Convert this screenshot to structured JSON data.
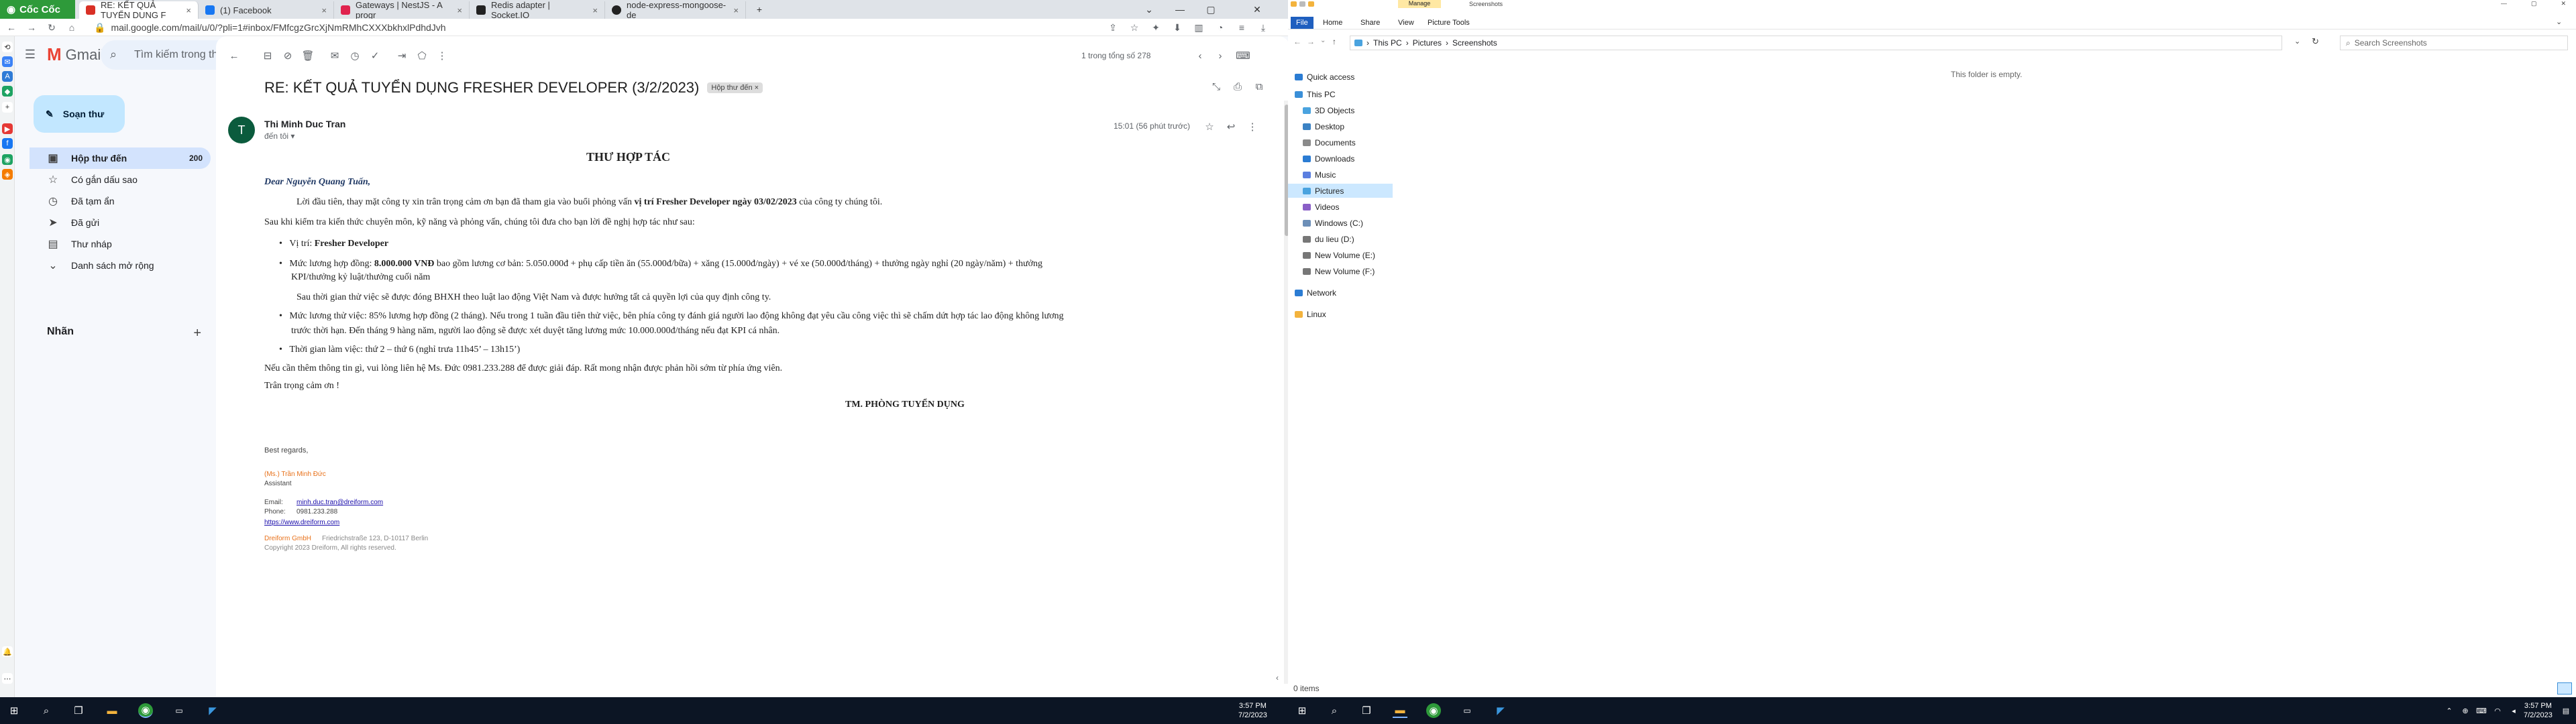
{
  "browser": {
    "brand": "Cốc Cốc",
    "tabs": [
      {
        "label": "RE: KẾT QUẢ TUYỂN DỤNG F",
        "color": "#d93025"
      },
      {
        "label": "(1) Facebook",
        "color": "#1877f2"
      },
      {
        "label": "Gateways | NestJS - A progr",
        "color": "#e0234e"
      },
      {
        "label": "Redis adapter | Socket.IO",
        "color": "#222222"
      },
      {
        "label": "node-express-mongoose-de",
        "color": "#222222"
      }
    ],
    "url": "mail.google.com/mail/u/0/?pli=1#inbox/FMfcgzGrcXjNmRMhCXXXbkhxlPdhdJvh"
  },
  "gmail": {
    "brand": "Gmail",
    "search_placeholder": "Tìm kiếm trong thư",
    "avatar_letter": "T",
    "compose_label": "Soạn thư",
    "nav": [
      {
        "label": "Hộp thư đến",
        "count": "200",
        "icon": "inbox-icon",
        "glyph": "▣"
      },
      {
        "label": "Có gắn dấu sao",
        "count": "",
        "icon": "star-icon",
        "glyph": "☆"
      },
      {
        "label": "Đã tạm ẩn",
        "count": "",
        "icon": "snooze-icon",
        "glyph": "◷"
      },
      {
        "label": "Đã gửi",
        "count": "",
        "icon": "send-icon",
        "glyph": "➤"
      },
      {
        "label": "Thư nháp",
        "count": "",
        "icon": "draft-icon",
        "glyph": "▤"
      },
      {
        "label": "Danh sách mở rộng",
        "count": "",
        "icon": "expand-icon",
        "glyph": "⌄"
      }
    ],
    "labels_title": "Nhãn",
    "labels_add": "+",
    "pager": "1 trong tổng số 278",
    "subject": "RE: KẾT QUẢ TUYỂN DỤNG FRESHER DEVELOPER (3/2/2023)",
    "subject_badge": "Hộp thư đến ×",
    "sender_name": "Thi Minh Duc Tran",
    "sender_to": "đến tôi ▾",
    "sender_avatar": "T",
    "time": "15:01 (56 phút trước)",
    "body": {
      "heading": "THƯ HỢP TÁC",
      "greeting": "Dear Nguyễn Quang Tuấn,",
      "p1_a": "Lời đầu tiên, thay mặt công ty xin trân trọng cảm ơn bạn đã tham gia vào buổi phỏng vấn ",
      "p1_b": "vị trí Fresher Developer ngày 03/02/2023",
      "p1_c": " của công ty chúng tôi.",
      "p2": "Sau khi kiểm tra kiến thức chuyên môn, kỹ năng và phỏng vấn, chúng tôi đưa cho bạn lời đề nghị hợp tác như sau:",
      "b1_a": "Vị trí: ",
      "b1_b": "Fresher Developer",
      "b2_a": "Mức lương hợp đồng: ",
      "b2_b": "8.000.000 VNĐ",
      "b2_c": " bao gồm lương cơ bản: 5.050.000đ + phụ cấp tiền ăn (55.000đ/bữa) + xăng (15.000đ/ngày) + vé xe (50.000đ/tháng) + thưởng ngày nghỉ (20 ngày/năm) + thưởng",
      "b2_d": "KPI/thưởng kỷ luật/thưởng cuối năm",
      "p3": "Sau thời gian thử việc sẽ được đóng BHXH theo luật lao động Việt Nam và được hưởng tất cả quyền lợi của quy định công ty.",
      "b3_a": "Mức lương thử việc: 85% lương hợp đồng (2 tháng). Nếu trong 1 tuần đầu tiên thử việc, bên phía công ty đánh giá người lao động không đạt yêu cầu công việc thì sẽ chấm dứt hợp tác lao động không lương",
      "b3_b": "trước thời hạn. Đến tháng 9 hàng năm, người lao động sẽ được xét duyệt tăng lương mức 10.000.000đ/tháng nếu đạt KPI cá nhân.",
      "b4": "Thời gian làm việc: thứ 2 – thứ 6 (nghỉ trưa 11h45’ – 13h15’)",
      "p4": "Nếu cần thêm thông tin gì, vui lòng liên hệ Ms. Đức 0981.233.288 để được giải đáp. Rất mong nhận được phản hồi sớm từ phía ứng viên.",
      "p5": "Trân trọng cảm ơn !",
      "sign_dept": "TM. PHÒNG TUYỂN DỤNG",
      "regards": "Best regards,",
      "sig_name": "(Ms.) Trần Minh Đức",
      "sig_title": "Assistant",
      "email_label": "Email:",
      "email_value": "minh.duc.tran@dreiform.com",
      "phone_label": "Phone:",
      "phone_value": "0981.233.288",
      "website": "https://www.dreiform.com",
      "company": "Dreiform GmbH",
      "address": "Friedrichstraße 123, D-10117 Berlin",
      "copyright": "Copyright 2023 Dreiform, All rights reserved."
    }
  },
  "explorer": {
    "title": "Screenshots",
    "manage_label": "Manage",
    "ribbon_tabs": [
      "File",
      "Home",
      "Share",
      "View",
      "Picture Tools"
    ],
    "path": [
      "This PC",
      "Pictures",
      "Screenshots"
    ],
    "search_placeholder": "Search Screenshots",
    "empty_text": "This folder is empty.",
    "status": "0 items",
    "tree": [
      {
        "label": "Quick access",
        "color": "#2b7cd3",
        "indent": 0
      },
      {
        "label": "This PC",
        "color": "#3a8fd8",
        "indent": 0
      },
      {
        "label": "3D Objects",
        "color": "#4aa3df",
        "indent": 1
      },
      {
        "label": "Desktop",
        "color": "#3b82c4",
        "indent": 1
      },
      {
        "label": "Documents",
        "color": "#8a8a8a",
        "indent": 1
      },
      {
        "label": "Downloads",
        "color": "#2b7cd3",
        "indent": 1
      },
      {
        "label": "Music",
        "color": "#5b7fe0",
        "indent": 1
      },
      {
        "label": "Pictures",
        "color": "#4aa3df",
        "indent": 1,
        "selected": true
      },
      {
        "label": "Videos",
        "color": "#8a5fc7",
        "indent": 1
      },
      {
        "label": "Windows (C:)",
        "color": "#6d8fb8",
        "indent": 1
      },
      {
        "label": "du lieu (D:)",
        "color": "#777777",
        "indent": 1
      },
      {
        "label": "New Volume (E:)",
        "color": "#777777",
        "indent": 1
      },
      {
        "label": "New Volume (F:)",
        "color": "#777777",
        "indent": 1
      },
      {
        "label": "Network",
        "color": "#2b7cd3",
        "indent": 0
      },
      {
        "label": "Linux",
        "color": "#f3b33d",
        "indent": 0
      }
    ]
  },
  "taskbar": {
    "time": "3:57 PM",
    "date": "7/2/2023"
  }
}
